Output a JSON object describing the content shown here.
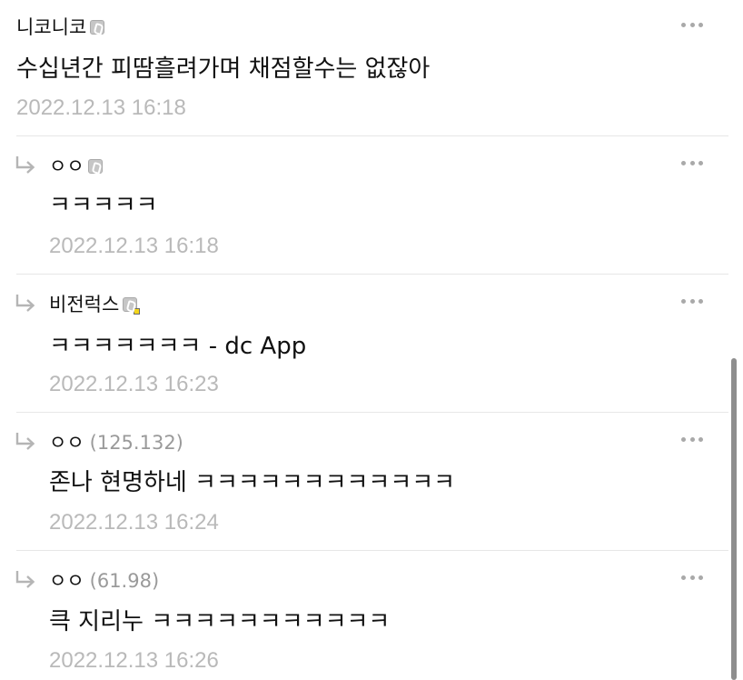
{
  "comments": [
    {
      "author": "니코니코",
      "ip": "",
      "content": "수십년간 피땀흘려가며 채점할수는 없잖아",
      "time": "2022.12.13 16:18",
      "is_reply": false,
      "badge": "fixed-nickname-gallog-icon"
    },
    {
      "author": "ㅇㅇ",
      "ip": "",
      "content": "ㅋㅋㅋㅋㅋ",
      "time": "2022.12.13 16:18",
      "is_reply": true,
      "badge": "fixed-nickname-gallog-icon"
    },
    {
      "author": "비전럭스",
      "ip": "",
      "content": "ㅋㅋㅋㅋㅋㅋㅋ - dc App",
      "time": "2022.12.13 16:23",
      "is_reply": true,
      "badge": "semi-fixed-nickname-gallog-icon"
    },
    {
      "author": "ㅇㅇ",
      "ip": "(125.132)",
      "content": "존나 현명하네 ㅋㅋㅋㅋㅋㅋㅋㅋㅋㅋㅋㅋ",
      "time": "2022.12.13 16:24",
      "is_reply": true,
      "badge": ""
    },
    {
      "author": "ㅇㅇ",
      "ip": "(61.98)",
      "content": "큭 지리누 ㅋㅋㅋㅋㅋㅋㅋㅋㅋㅋㅋ",
      "time": "2022.12.13 16:26",
      "is_reply": true,
      "badge": ""
    }
  ],
  "icons": {
    "reply": "reply-arrow-icon",
    "more": "more-options-icon"
  },
  "colors": {
    "text": "#111111",
    "timestamp": "#b9b9b9",
    "ip": "#9a9a9a",
    "divider": "#e7e7e7",
    "badge_dot": "#f3d51a"
  }
}
